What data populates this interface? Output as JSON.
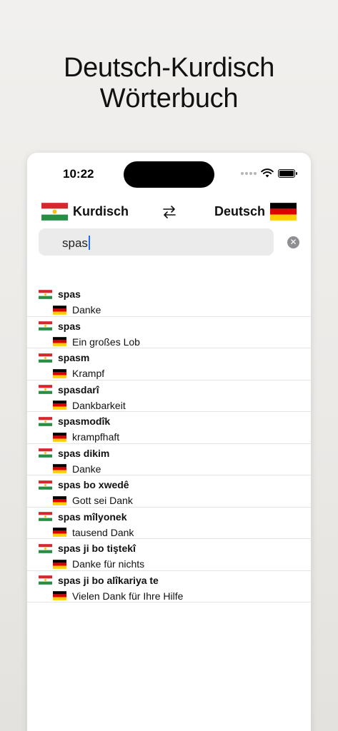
{
  "headline": {
    "line1": "Deutsch-Kurdisch",
    "line2": "Wörterbuch"
  },
  "status_bar": {
    "time": "10:22"
  },
  "languages": {
    "source": "Kurdisch",
    "target": "Deutsch"
  },
  "search": {
    "value": "spas",
    "placeholder": ""
  },
  "colors": {
    "kurdistan_red": "#d6262e",
    "kurdistan_white": "#ffffff",
    "kurdistan_green": "#278e43",
    "kurdistan_sun": "#fcc10a",
    "germany_black": "#000000",
    "germany_red": "#dd0000",
    "germany_gold": "#ffce00"
  },
  "results": [
    {
      "term": "spas",
      "translation": "Danke"
    },
    {
      "term": "spas",
      "translation": "Ein großes Lob"
    },
    {
      "term": "spasm",
      "translation": "Krampf"
    },
    {
      "term": "spasdarî",
      "translation": "Dankbarkeit"
    },
    {
      "term": "spasmodîk",
      "translation": "krampfhaft"
    },
    {
      "term": "spas dikim",
      "translation": "Danke"
    },
    {
      "term": "spas bo xwedê",
      "translation": "Gott sei Dank"
    },
    {
      "term": "spas mîlyonek",
      "translation": "tausend Dank"
    },
    {
      "term": "spas ji bo tiştekî",
      "translation": "Danke für nichts"
    },
    {
      "term": "spas ji bo alîkariya te",
      "translation": "Vielen Dank für Ihre Hilfe"
    }
  ]
}
